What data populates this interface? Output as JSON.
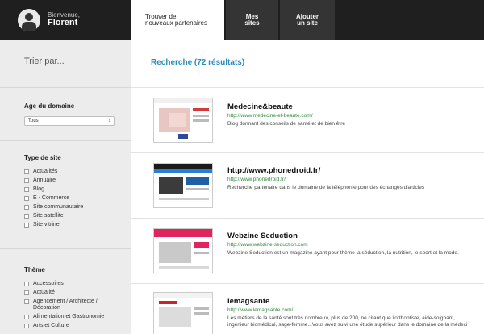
{
  "header": {
    "greeting": "Bienvenue,",
    "user_name": "Florent",
    "tabs": [
      {
        "label_line1": "Trouver de",
        "label_line2": "nouveaux partenaires"
      },
      {
        "label_line1": "Mes",
        "label_line2": "sites"
      },
      {
        "label_line1": "Ajouter",
        "label_line2": "un site"
      }
    ]
  },
  "sidebar": {
    "sort_label": "Trier par...",
    "domain_age": {
      "heading": "Age du domaine",
      "selected": "Tous"
    },
    "site_type": {
      "heading": "Type de site",
      "options": [
        "Actualités",
        "Annuaire",
        "Blog",
        "E - Commerce",
        "Site communautaire",
        "Site satellite",
        "Site vitrine"
      ]
    },
    "theme": {
      "heading": "Thème",
      "options": [
        "Accessoires",
        "Actualité",
        "Agencement / Architecte / Décoration",
        "Alimentation et Gastronomie",
        "Arts et Culture"
      ]
    }
  },
  "main": {
    "results_title": "Recherche (72 résultats)",
    "results": [
      {
        "title": "Medecine&beaute",
        "url": "http://www.medecine-et-beaute.com/",
        "description": "Blog donnant des conseils de santé et de bien être"
      },
      {
        "title": "http://www.phonedroid.fr/",
        "url": "http://www.phonedroid.fr/",
        "description": "Recherche partenaire dans le domaine de la téléphonie pour des échanges d'articles"
      },
      {
        "title": "Webzine Seduction",
        "url": "http://www.webzine-seduction.com",
        "description": "Webzine Seduction est un magazine ayant pour thème la séduction, la nutrition, le sport et la mode."
      },
      {
        "title": "lemagsante",
        "url": "http://www.lemagsante.com/",
        "description": "Les métiers de la santé sont très nombreux, plus de 200, ne citant que l'orthoptiste, aide-soignant, ingénieur biomédical, sage-femme...Vous avez suivi une étude supérieur dans le domaine de la médeci"
      }
    ]
  }
}
